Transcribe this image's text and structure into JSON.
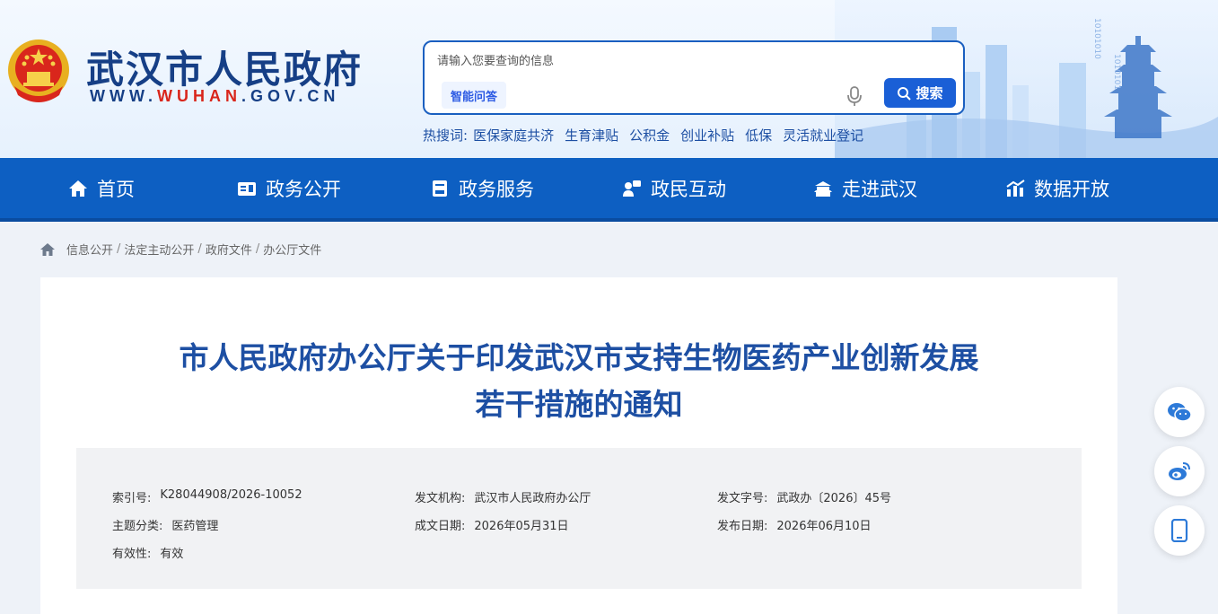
{
  "header": {
    "site_title": "武汉市人民政府",
    "url_prefix": "WWW.",
    "url_mid": "WUHAN",
    "url_suffix": ".GOV.CN"
  },
  "search": {
    "placeholder": "请输入您要查询的信息",
    "ai_button": "智能问答",
    "search_button": "搜索",
    "hot_label": "热搜词:",
    "hot_terms": [
      "医保家庭共济",
      "生育津贴",
      "公积金",
      "创业补贴",
      "低保",
      "灵活就业登记"
    ]
  },
  "nav": {
    "items": [
      {
        "label": "首页",
        "icon": "home-icon"
      },
      {
        "label": "政务公开",
        "icon": "open-gov-icon"
      },
      {
        "label": "政务服务",
        "icon": "service-icon"
      },
      {
        "label": "政民互动",
        "icon": "interaction-icon"
      },
      {
        "label": "走进武汉",
        "icon": "landmark-icon"
      },
      {
        "label": "数据开放",
        "icon": "data-chart-icon"
      }
    ]
  },
  "breadcrumb": [
    "信息公开",
    "法定主动公开",
    "政府文件",
    "办公厅文件"
  ],
  "document": {
    "title_line1": "市人民政府办公厅关于印发武汉市支持生物医药产业创新发展",
    "title_line2": "若干措施的通知",
    "meta": {
      "index_label": "索引号:",
      "index_value": "K28044908/2026-10052",
      "issuer_label": "发文机构:",
      "issuer_value": "武汉市人民政府办公厅",
      "doc_no_label": "发文字号:",
      "doc_no_value": "武政办〔2026〕45号",
      "topic_label": "主题分类:",
      "topic_value": "医药管理",
      "written_label": "成文日期:",
      "written_value": "2026年05月31日",
      "published_label": "发布日期:",
      "published_value": "2026年06月10日",
      "validity_label": "有效性:",
      "validity_value": "有效"
    }
  },
  "side_buttons": [
    "wechat-icon",
    "weibo-icon",
    "mobile-icon"
  ],
  "colors": {
    "brand_blue": "#0d5fc2",
    "title_blue": "#1d4fa3",
    "url_red": "#d9261c"
  }
}
